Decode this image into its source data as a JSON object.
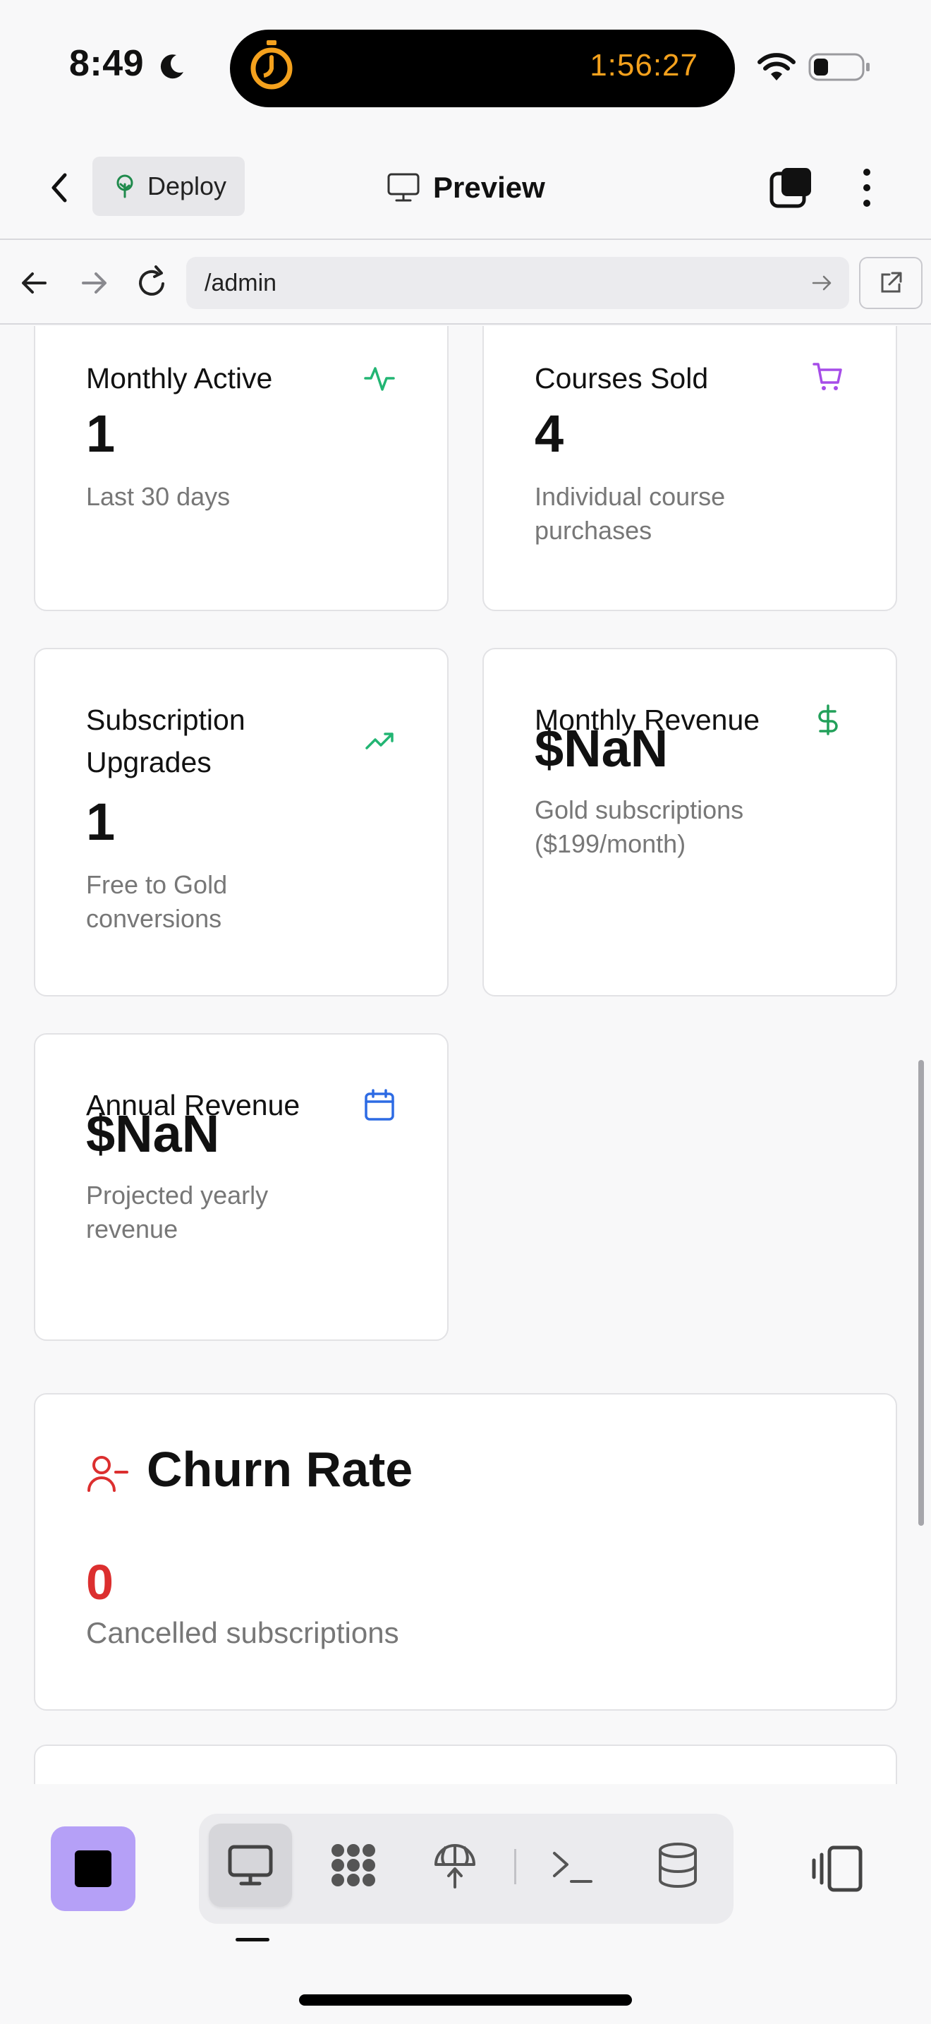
{
  "status_bar": {
    "time": "8:49",
    "timer": "1:56:27",
    "timer_color": "#f4a11d"
  },
  "toolbar": {
    "deploy_label": "Deploy",
    "preview_label": "Preview"
  },
  "url_bar": {
    "url": "/admin"
  },
  "stats": [
    {
      "title": "Monthly Active",
      "value": "1",
      "sub": "Last 30 days",
      "icon": "activity-icon",
      "icon_color": "#22b573"
    },
    {
      "title": "Courses Sold",
      "value": "4",
      "sub": "Individual course purchases",
      "icon": "cart-icon",
      "icon_color": "#a64de8"
    },
    {
      "title": "Subscription Upgrades",
      "value": "1",
      "sub": "Free to Gold conversions",
      "icon": "trending-up-icon",
      "icon_color": "#22b573"
    },
    {
      "title": "Monthly Revenue",
      "value": "$NaN",
      "sub": "Gold subscriptions ($199/month)",
      "icon": "dollar-icon",
      "icon_color": "#22a05a"
    },
    {
      "title": "Annual Revenue",
      "value": "$NaN",
      "sub": "Projected yearly revenue",
      "icon": "calendar-icon",
      "icon_color": "#2d6be4"
    }
  ],
  "churn": {
    "title": "Churn Rate",
    "value": "0",
    "sub": "Cancelled subscriptions",
    "accent": "#dc2f2f"
  },
  "dock": {
    "tabs": [
      "monitor-icon",
      "apps-icon",
      "deploy-icon",
      "terminal-icon",
      "database-icon"
    ],
    "active_tab": "monitor-icon",
    "accent": "#b5a0f7"
  }
}
